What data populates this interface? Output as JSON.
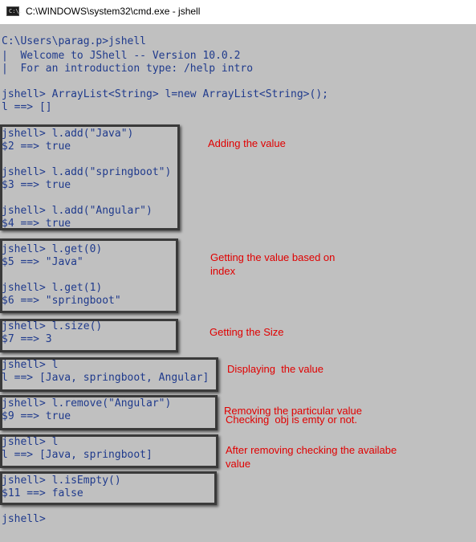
{
  "window": {
    "icon": "cmd-icon",
    "icon_text": "C:\\.",
    "title": "C:\\WINDOWS\\system32\\cmd.exe - jshell"
  },
  "console": {
    "text_color": "#1f3a8c",
    "background": "#c0c0c0",
    "lines": [
      "C:\\Users\\parag.p>jshell",
      "|  Welcome to JShell -- Version 10.0.2",
      "|  For an introduction type: /help intro",
      "jshell> ArrayList<String> l=new ArrayList<String>();",
      "l ==> []",
      "jshell> l.add(\"Java\")",
      "$2 ==> true",
      "jshell> l.add(\"springboot\")",
      "$3 ==> true",
      "jshell> l.add(\"Angular\")",
      "$4 ==> true",
      "jshell> l.get(0)",
      "$5 ==> \"Java\"",
      "jshell> l.get(1)",
      "$6 ==> \"springboot\"",
      "jshell> l.size()",
      "$7 ==> 3",
      "jshell> l",
      "l ==> [Java, springboot, Angular]",
      "jshell> l.remove(\"Angular\")",
      "$9 ==> true",
      "jshell> l",
      "l ==> [Java, springboot]",
      "jshell> l.isEmpty()",
      "$11 ==> false",
      "jshell>"
    ]
  },
  "annotations": {
    "color": "#e00000",
    "items": [
      "Adding the value",
      "Getting the value based on\nindex",
      "Getting the Size",
      "Displaying  the value",
      "Removing the particular value",
      "Checking  obj is emty or not.",
      "After removing checking the availabe\nvalue"
    ]
  }
}
